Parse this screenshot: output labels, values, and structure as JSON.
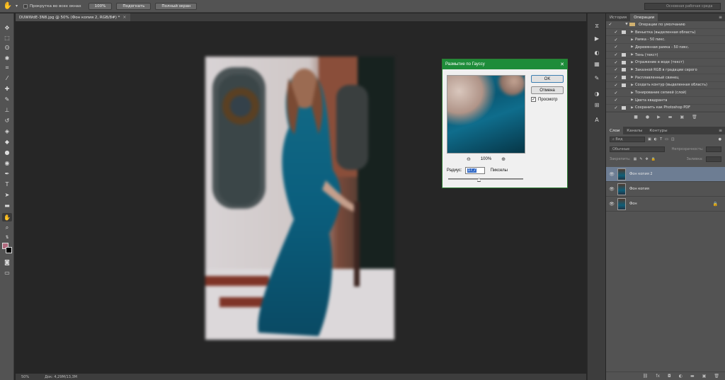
{
  "options_bar": {
    "scroll_all_label": "Прокрутка во всех окнах",
    "btn_100": "100%",
    "btn_fit": "Подогнать",
    "btn_fill": "Полный экран",
    "workspace": "Основная рабочая среда"
  },
  "document": {
    "tab_title": "DUWWdE-3N8.jpg @ 50% (Фон копия 2, RGB/8#) *",
    "tab_close": "×"
  },
  "status_bar": {
    "zoom": "50%",
    "doc_info": "Док: 4,29М/13,3М"
  },
  "actions_panel": {
    "tabs": [
      "История",
      "Операции"
    ],
    "active_tab": 1,
    "set_name": "Операции по умолчанию",
    "items": [
      "Виньетка (выделенная область)",
      "Рамка - 50 пикс.",
      "Деревянная рамка - 50 пикс.",
      "Тень (текст)",
      "Отражение в воде (текст)",
      "Заказной RGB в градации серого",
      "Расплавленный свинец",
      "Создать контур (выделенная область)",
      "Тонирование сепией (слой)",
      "Цвета квадранта",
      "Сохранить как Photoshop PDF"
    ]
  },
  "layers_panel": {
    "tabs": [
      "Слои",
      "Каналы",
      "Контуры"
    ],
    "active_tab": 0,
    "filter_label": "Вид",
    "blend_mode": "Обычные",
    "opacity_label": "Непрозрачность:",
    "lock_label": "Закрепить:",
    "fill_label": "Заливка:",
    "layers": [
      {
        "name": "Фон копия 2",
        "selected": true,
        "locked": false
      },
      {
        "name": "Фон копия",
        "selected": false,
        "locked": false
      },
      {
        "name": "Фон",
        "selected": false,
        "locked": true
      }
    ]
  },
  "gaussian_dialog": {
    "title": "Размытие по Гауссу",
    "ok": "OK",
    "cancel": "Отмена",
    "preview_label": "Просмотр",
    "preview_checked": true,
    "zoom": "100%",
    "radius_label": "Радиус:",
    "radius_value": "17,7",
    "units": "Пикселы"
  },
  "colors": {
    "foreground": "#b06a7e",
    "background": "#000000",
    "dialog_title_bar": "#1e8c3a",
    "selected_layer": "#6d7d93"
  }
}
